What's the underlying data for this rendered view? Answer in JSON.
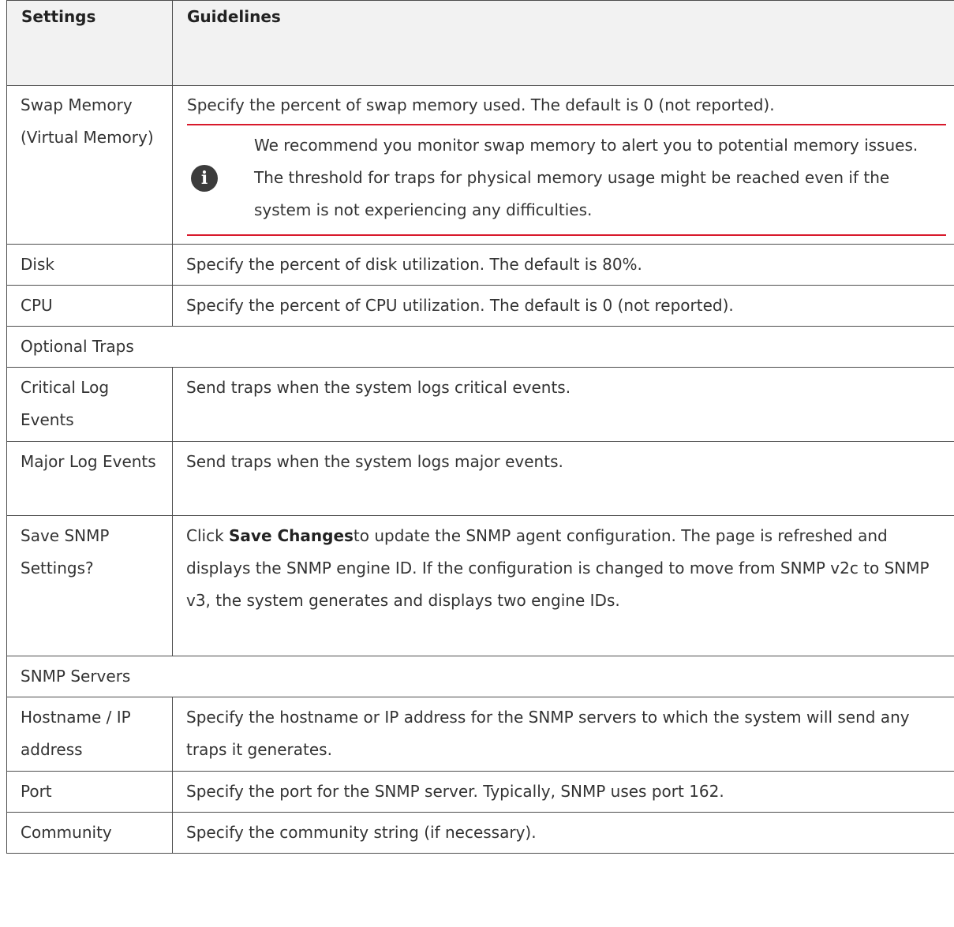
{
  "table": {
    "headers": [
      "Settings",
      "Guidelines"
    ],
    "swap": {
      "setting": "Swap Memory (Virtual Memory)",
      "guideline": "Specify the percent of swap memory used. The default is 0 (not reported).",
      "note": "We recommend you monitor swap memory to alert you to potential memory issues. The threshold for traps for physical memory usage might be reached even if the system is not experiencing any difficulties.",
      "note_icon": "info-icon"
    },
    "disk": {
      "setting": "Disk",
      "guideline": "Specify the percent of disk utilization. The default is 80%."
    },
    "cpu": {
      "setting": "CPU",
      "guideline": "Specify the percent of CPU utilization. The default is 0 (not reported)."
    },
    "optional_traps": "Optional Traps",
    "critical": {
      "setting": "Critical Log Events",
      "guideline": "Send traps when the system logs critical events."
    },
    "major": {
      "setting": "Major Log Events",
      "guideline": "Send traps when the system logs major events."
    },
    "save": {
      "setting": "Save SNMP Settings?",
      "prefix": "Click ",
      "bold": "Save Changes",
      "suffix": "to update the SNMP agent configuration. The page is refreshed and displays the SNMP engine ID. If the configuration is changed to move from SNMP v2c to SNMP v3, the system generates and displays two engine IDs."
    },
    "snmp_servers": "SNMP Servers",
    "hostname": {
      "setting": "Hostname / IP address",
      "guideline": "Specify the hostname or IP address for the SNMP servers to which the system will send any traps it generates."
    },
    "port": {
      "setting": "Port",
      "guideline": "Specify the port for the SNMP server. Typically, SNMP uses port 162."
    },
    "community": {
      "setting": "Community",
      "guideline": "Specify the community string (if necessary)."
    }
  },
  "colors": {
    "accent_line": "#d8192b",
    "header_bg": "#f2f2f2",
    "border": "#4d4d4d"
  }
}
